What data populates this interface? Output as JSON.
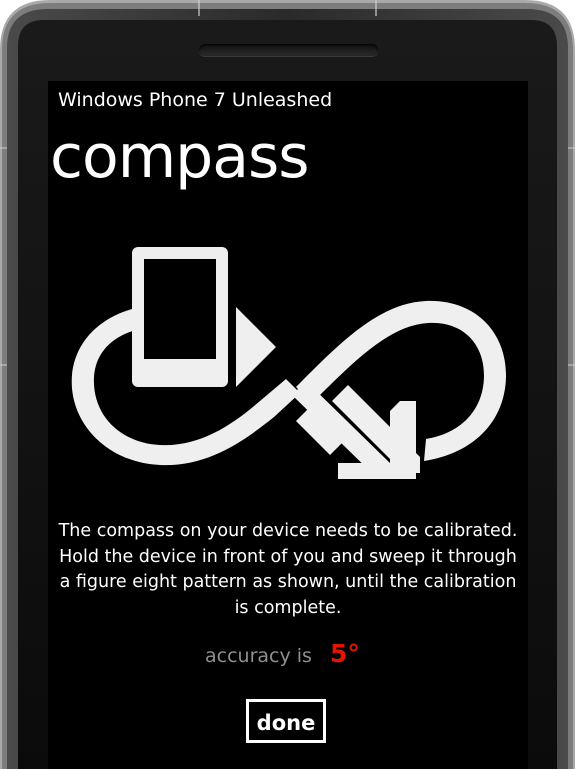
{
  "app": {
    "title": "Windows Phone 7 Unleashed"
  },
  "page": {
    "title": "compass"
  },
  "calibration": {
    "instructions": "The compass on your device needs to be calibrated. Hold the device in front of you and sweep it through a figure eight pattern as shown, until the calibration is complete.",
    "accuracy_label": "accuracy is",
    "accuracy_value": "5°",
    "accuracy_color": "#e51400",
    "graphic_icon": "figure-eight-calibration-icon"
  },
  "actions": {
    "done_label": "done"
  },
  "colors": {
    "screen_background": "#000000",
    "foreground": "#ffffff",
    "subtle_text": "#8f8f8f",
    "graphic_fill": "#efefef"
  }
}
